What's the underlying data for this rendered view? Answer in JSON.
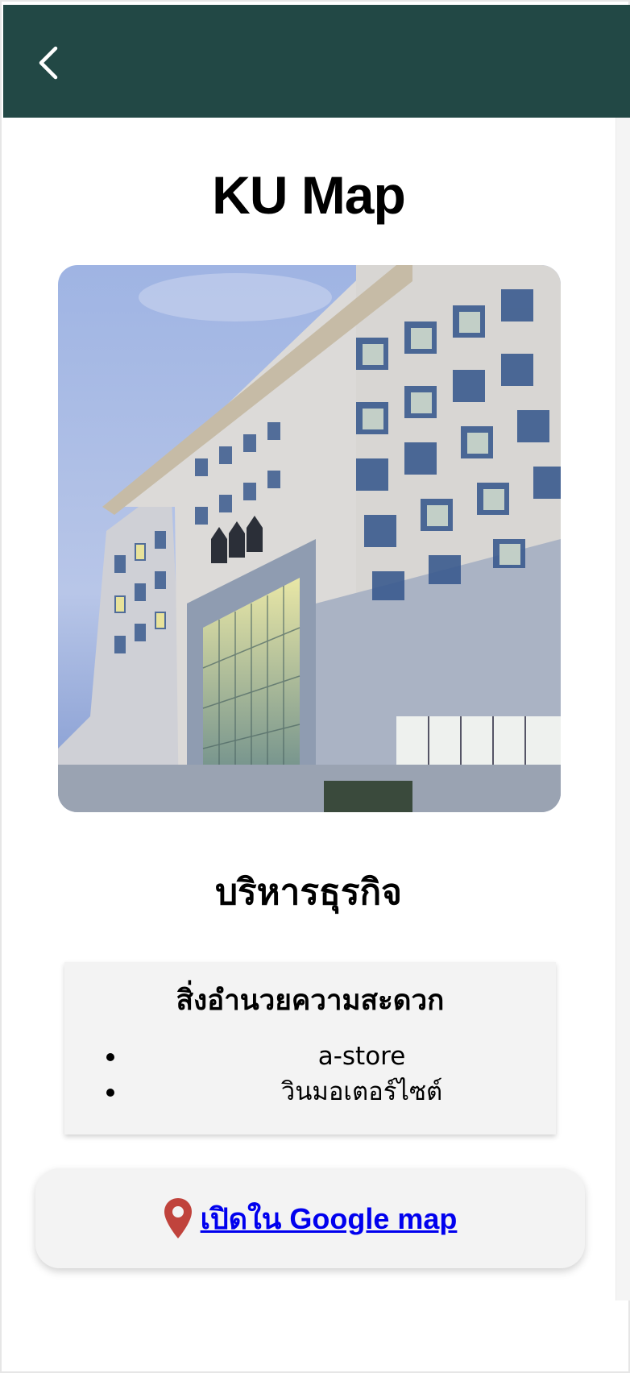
{
  "header": {
    "back_icon": "chevron-left-icon",
    "background_color": "#224845"
  },
  "page": {
    "title": "KU Map",
    "place_name": "บริหารธุรกิจ"
  },
  "amenities": {
    "heading": "สิ่งอำนวยความสะดวก",
    "items": [
      {
        "label": "a-store"
      },
      {
        "label": "วินมอเตอร์ไซต์"
      }
    ]
  },
  "map_link": {
    "icon": "map-pin-icon",
    "label": "เปิดใน Google map",
    "pin_color": "#c0433c"
  }
}
